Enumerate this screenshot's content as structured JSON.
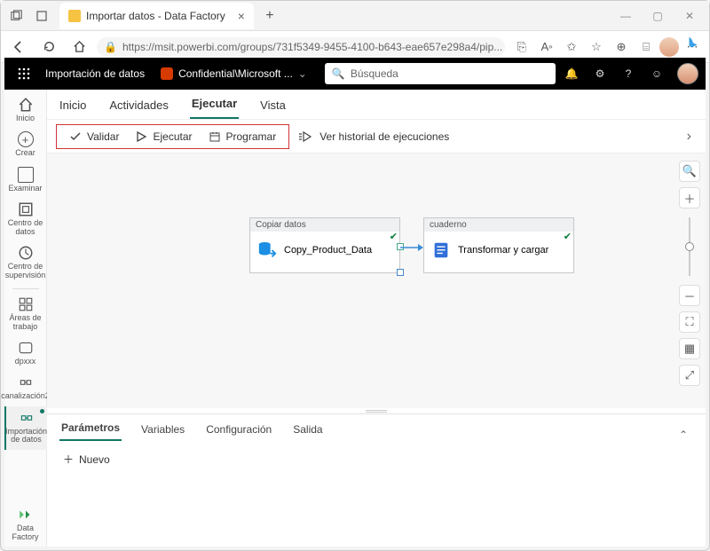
{
  "browser": {
    "tab_title": "Importar datos - Data Factory",
    "url": "https://msit.powerbi.com/groups/731f5349-9455-4100-b643-eae657e298a4/pip..."
  },
  "appbar": {
    "breadcrumb": "Importación de datos",
    "sensitivity": "Confidential\\Microsoft ...",
    "search_placeholder": "Búsqueda"
  },
  "rail": {
    "home": "Inicio",
    "create": "Crear",
    "browse": "Examinar",
    "datacenter": "Centro de datos",
    "monitor": "Centro de supervisión",
    "workspaces": "Áreas de trabajo",
    "ws1": "dpxxx",
    "ws2": "canalización2",
    "ws3": "Importación de datos",
    "footer": "Data Factory"
  },
  "tabs": {
    "home": "Inicio",
    "activities": "Actividades",
    "run": "Ejecutar",
    "view": "Vista"
  },
  "toolbar": {
    "validate": "Validar",
    "execute": "Ejecutar",
    "schedule": "Programar",
    "history": "Ver historial de ejecuciones"
  },
  "canvas": {
    "node1": {
      "header": "Copiar datos",
      "label": "Copy_Product_Data"
    },
    "node2": {
      "header": "cuaderno",
      "label": "Transformar y cargar"
    }
  },
  "bottom": {
    "params": "Parámetros",
    "vars": "Variables",
    "config": "Configuración",
    "output": "Salida",
    "new": "Nuevo"
  }
}
